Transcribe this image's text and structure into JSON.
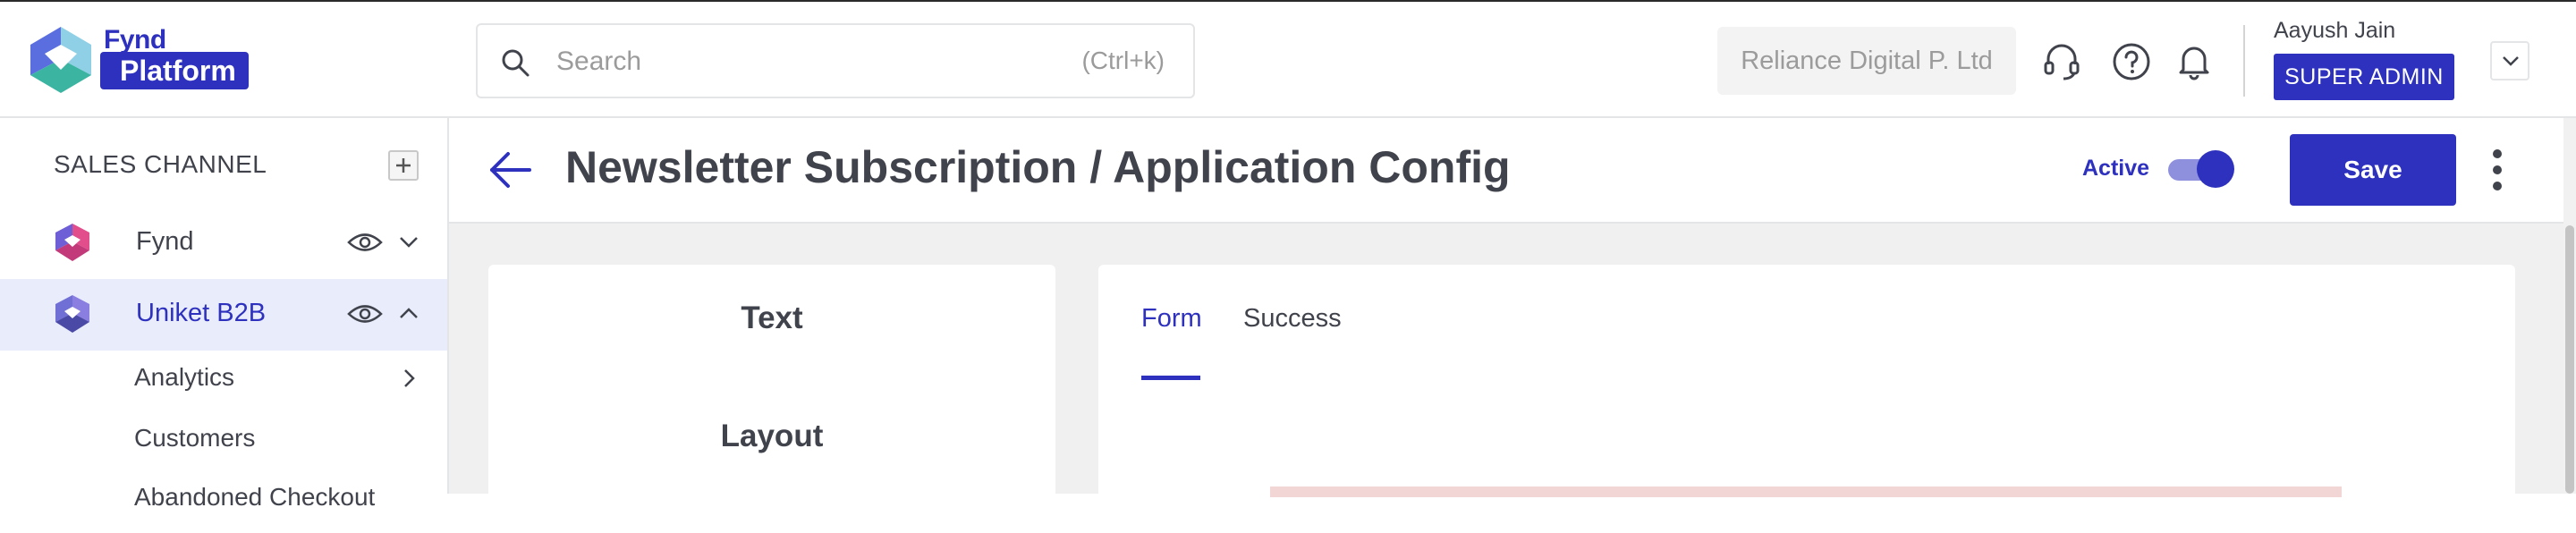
{
  "brand": {
    "logo_top": "Fynd",
    "logo_badge": "Platform"
  },
  "header": {
    "search_placeholder": "Search",
    "search_shortcut": "(Ctrl+k)",
    "company": "Reliance Digital P. Ltd",
    "user_name": "Aayush Jain",
    "user_role": "SUPER ADMIN"
  },
  "sidebar": {
    "title": "SALES CHANNEL",
    "channels": [
      {
        "label": "Fynd",
        "expanded": false
      },
      {
        "label": "Uniket B2B",
        "expanded": true
      }
    ],
    "sub_items": [
      {
        "label": "Analytics",
        "has_children": true
      },
      {
        "label": "Customers",
        "has_children": false
      },
      {
        "label": "Abandoned Checkout",
        "has_children": false
      }
    ]
  },
  "page": {
    "title": "Newsletter Subscription / Application Config",
    "status_label": "Active",
    "status_on": true,
    "save_label": "Save"
  },
  "left_panel": {
    "items": [
      "Text",
      "Layout"
    ]
  },
  "tabs": [
    {
      "label": "Form",
      "active": true
    },
    {
      "label": "Success",
      "active": false
    }
  ],
  "colors": {
    "primary": "#2e31be",
    "text": "#41434c",
    "muted": "#9b9b9b",
    "active_bg": "#e8ecfb",
    "content_bg": "#f0f0f0"
  }
}
